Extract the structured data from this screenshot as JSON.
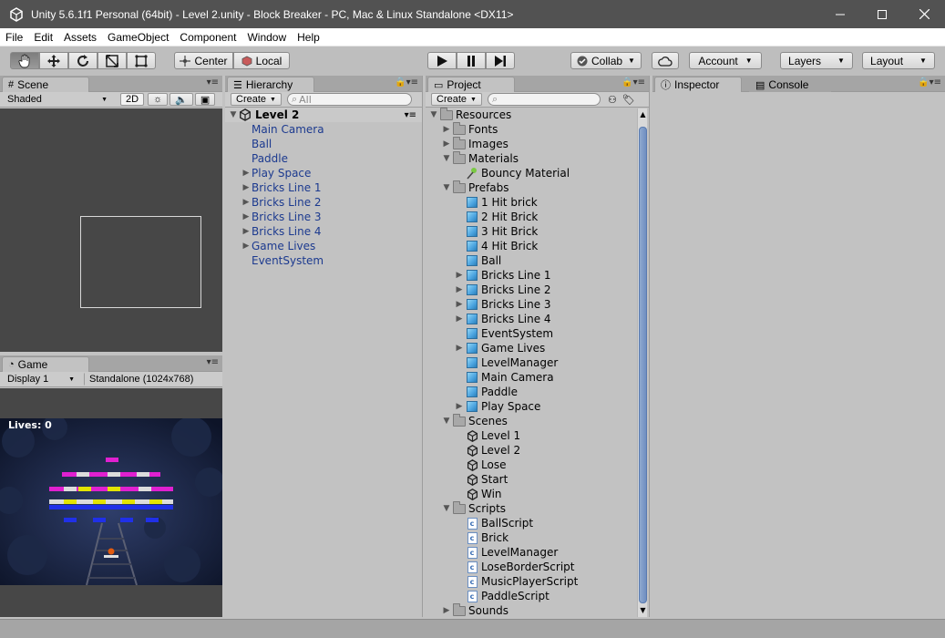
{
  "window": {
    "title": "Unity 5.6.1f1 Personal (64bit) - Level 2.unity - Block Breaker - PC, Mac & Linux Standalone <DX11>"
  },
  "menu": [
    "File",
    "Edit",
    "Assets",
    "GameObject",
    "Component",
    "Window",
    "Help"
  ],
  "toolbar": {
    "center_label": "Center",
    "local_label": "Local",
    "collab_label": "Collab",
    "account_label": "Account",
    "layers_label": "Layers",
    "layout_label": "Layout"
  },
  "scene": {
    "tab_label": "Scene",
    "shading_mode": "Shaded",
    "mode_2d": "2D"
  },
  "game": {
    "tab_label": "Game",
    "display": "Display 1",
    "resolution": "Standalone (1024x768)",
    "lives_text": "Lives: 0"
  },
  "hierarchy": {
    "tab_label": "Hierarchy",
    "create_label": "Create",
    "search_placeholder": "All",
    "root": "Level 2",
    "items": [
      {
        "label": "Main Camera",
        "expandable": false
      },
      {
        "label": "Ball",
        "expandable": false
      },
      {
        "label": "Paddle",
        "expandable": false
      },
      {
        "label": "Play Space",
        "expandable": true
      },
      {
        "label": "Bricks Line 1",
        "expandable": true
      },
      {
        "label": "Bricks Line 2",
        "expandable": true
      },
      {
        "label": "Bricks Line 3",
        "expandable": true
      },
      {
        "label": "Bricks Line 4",
        "expandable": true
      },
      {
        "label": "Game Lives",
        "expandable": true
      },
      {
        "label": "EventSystem",
        "expandable": false
      }
    ]
  },
  "project": {
    "tab_label": "Project",
    "create_label": "Create",
    "items": [
      {
        "label": "Resources",
        "depth": 0,
        "type": "folder",
        "arrow": "open"
      },
      {
        "label": "Fonts",
        "depth": 1,
        "type": "folder",
        "arrow": "closed"
      },
      {
        "label": "Images",
        "depth": 1,
        "type": "folder",
        "arrow": "closed"
      },
      {
        "label": "Materials",
        "depth": 1,
        "type": "folder",
        "arrow": "open"
      },
      {
        "label": "Bouncy Material",
        "depth": 2,
        "type": "material",
        "arrow": "none"
      },
      {
        "label": "Prefabs",
        "depth": 1,
        "type": "folder",
        "arrow": "open"
      },
      {
        "label": "1 Hit brick",
        "depth": 2,
        "type": "prefab",
        "arrow": "none"
      },
      {
        "label": "2 Hit Brick",
        "depth": 2,
        "type": "prefab",
        "arrow": "none"
      },
      {
        "label": "3 Hit Brick",
        "depth": 2,
        "type": "prefab",
        "arrow": "none"
      },
      {
        "label": "4 Hit Brick",
        "depth": 2,
        "type": "prefab",
        "arrow": "none"
      },
      {
        "label": "Ball",
        "depth": 2,
        "type": "prefab",
        "arrow": "none"
      },
      {
        "label": "Bricks Line 1",
        "depth": 2,
        "type": "prefab",
        "arrow": "closed"
      },
      {
        "label": "Bricks Line 2",
        "depth": 2,
        "type": "prefab",
        "arrow": "closed"
      },
      {
        "label": "Bricks Line 3",
        "depth": 2,
        "type": "prefab",
        "arrow": "closed"
      },
      {
        "label": "Bricks Line 4",
        "depth": 2,
        "type": "prefab",
        "arrow": "closed"
      },
      {
        "label": "EventSystem",
        "depth": 2,
        "type": "prefab",
        "arrow": "none"
      },
      {
        "label": "Game Lives",
        "depth": 2,
        "type": "prefab",
        "arrow": "closed"
      },
      {
        "label": "LevelManager",
        "depth": 2,
        "type": "prefab",
        "arrow": "none"
      },
      {
        "label": "Main Camera",
        "depth": 2,
        "type": "prefab",
        "arrow": "none"
      },
      {
        "label": "Paddle",
        "depth": 2,
        "type": "prefab",
        "arrow": "none"
      },
      {
        "label": "Play Space",
        "depth": 2,
        "type": "prefab",
        "arrow": "closed"
      },
      {
        "label": "Scenes",
        "depth": 1,
        "type": "folder",
        "arrow": "open"
      },
      {
        "label": "Level 1",
        "depth": 2,
        "type": "scene",
        "arrow": "none"
      },
      {
        "label": "Level 2",
        "depth": 2,
        "type": "scene",
        "arrow": "none"
      },
      {
        "label": "Lose",
        "depth": 2,
        "type": "scene",
        "arrow": "none"
      },
      {
        "label": "Start",
        "depth": 2,
        "type": "scene",
        "arrow": "none"
      },
      {
        "label": "Win",
        "depth": 2,
        "type": "scene",
        "arrow": "none"
      },
      {
        "label": "Scripts",
        "depth": 1,
        "type": "folder",
        "arrow": "open"
      },
      {
        "label": "BallScript",
        "depth": 2,
        "type": "script",
        "arrow": "none"
      },
      {
        "label": "Brick",
        "depth": 2,
        "type": "script",
        "arrow": "none"
      },
      {
        "label": "LevelManager",
        "depth": 2,
        "type": "script",
        "arrow": "none"
      },
      {
        "label": "LoseBorderScript",
        "depth": 2,
        "type": "script",
        "arrow": "none"
      },
      {
        "label": "MusicPlayerScript",
        "depth": 2,
        "type": "script",
        "arrow": "none"
      },
      {
        "label": "PaddleScript",
        "depth": 2,
        "type": "script",
        "arrow": "none"
      },
      {
        "label": "Sounds",
        "depth": 1,
        "type": "folder",
        "arrow": "closed"
      }
    ]
  },
  "inspector": {
    "tab_label": "Inspector",
    "console_tab_label": "Console"
  },
  "colors": {
    "hierarchy_text": "#1c3a8f",
    "titlebar": "#525252",
    "panel_bg": "#c2c2c2"
  }
}
